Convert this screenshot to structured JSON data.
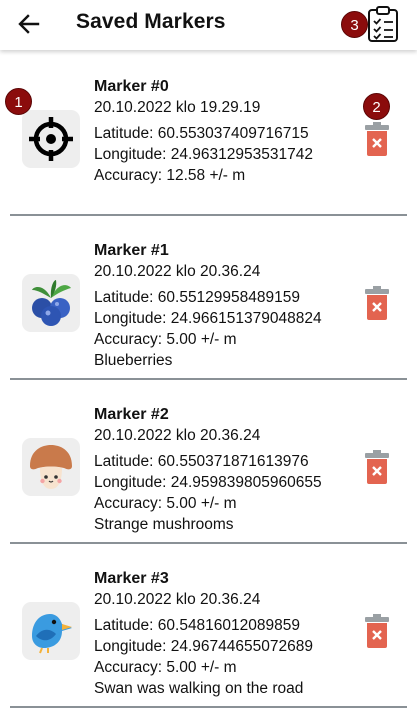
{
  "header": {
    "title": "Saved Markers",
    "back_icon": "arrow-left-icon",
    "action_icon": "clipboard-checklist-icon"
  },
  "badges": [
    "1",
    "2",
    "3"
  ],
  "colors": {
    "badge": "#8b0c0c",
    "trash": "#e36450",
    "divider": "#8a9196",
    "tile": "#eeeeee"
  },
  "markers": [
    {
      "name": "Marker #0",
      "date": "20.10.2022 klo 19.29.19",
      "latitude": "Latitude: 60.553037409716715",
      "longitude": "Longitude: 24.96312953531742",
      "accuracy": "Accuracy: 12.58 +/- m",
      "note": "",
      "icon": "crosshair-icon"
    },
    {
      "name": "Marker #1",
      "date": "20.10.2022 klo 20.36.24",
      "latitude": "Latitude: 60.55129958489159",
      "longitude": "Longitude: 24.966151379048824",
      "accuracy": "Accuracy: 5.00 +/- m",
      "note": "Blueberries",
      "icon": "blueberries-icon"
    },
    {
      "name": "Marker #2",
      "date": "20.10.2022 klo 20.36.24",
      "latitude": "Latitude: 60.550371871613976",
      "longitude": "Longitude: 24.959839805960655",
      "accuracy": "Accuracy: 5.00 +/- m",
      "note": "Strange mushrooms",
      "icon": "mushroom-icon"
    },
    {
      "name": "Marker #3",
      "date": "20.10.2022 klo 20.36.24",
      "latitude": "Latitude: 60.54816012089859",
      "longitude": "Longitude: 24.96744655072689",
      "accuracy": "Accuracy: 5.00 +/- m",
      "note": "Swan was walking on the road",
      "icon": "bird-icon"
    }
  ]
}
